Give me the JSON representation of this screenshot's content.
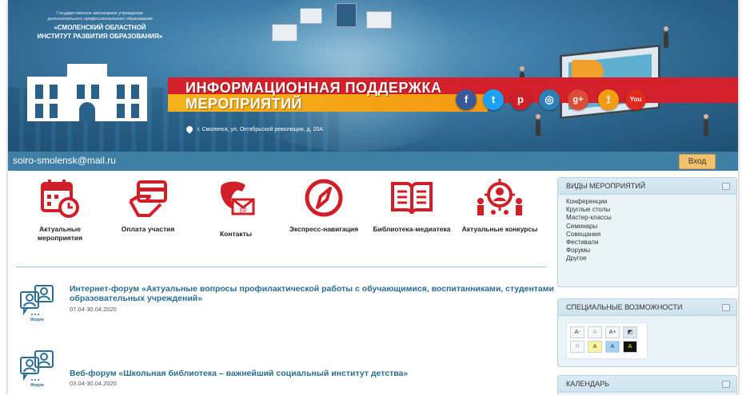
{
  "org": {
    "line1": "Государственное автономное учреждение",
    "line2": "дополнительного профессионального образования",
    "line3": "«СМОЛЕНСКИЙ ОБЛАСТНОЙ",
    "line4": "ИНСТИТУТ РАЗВИТИЯ ОБРАЗОВАНИЯ»"
  },
  "banner": {
    "title_line1": "ИНФОРМАЦИОННАЯ ПОДДЕРЖКА",
    "title_line2": "МЕРОПРИЯТИЙ",
    "address": "г. Смоленск, ул. Октябрьской революции, д. 20А",
    "social": [
      {
        "name": "facebook",
        "glyph": "f",
        "color": "#3b5998"
      },
      {
        "name": "twitter",
        "glyph": "t",
        "color": "#1da1f2"
      },
      {
        "name": "pinterest",
        "glyph": "p",
        "color": "#cb2027"
      },
      {
        "name": "instagram",
        "glyph": "◎",
        "color": "#2d7fb5"
      },
      {
        "name": "google-plus",
        "glyph": "g+",
        "color": "#dd4b39"
      },
      {
        "name": "rss",
        "glyph": "⟟",
        "color": "#f39c12"
      },
      {
        "name": "youtube",
        "glyph": "You",
        "color": "#e02a20"
      }
    ]
  },
  "topbar": {
    "email": "soiro-smolensk@mail.ru",
    "login_label": "Вход"
  },
  "tiles": [
    {
      "icon": "calendar-clock-icon",
      "label": "Актуальные мероприятия"
    },
    {
      "icon": "payment-card-icon",
      "label": "Оплата участия"
    },
    {
      "icon": "phone-mail-icon",
      "label": "Контакты"
    },
    {
      "icon": "compass-icon",
      "label": "Экспресс-навигация"
    },
    {
      "icon": "open-book-icon",
      "label": "Библиотека-медиатека"
    },
    {
      "icon": "people-target-icon",
      "label": "Актуальные конкурсы"
    }
  ],
  "news": [
    {
      "title": "Интернет-форум «Актуальные вопросы профилактической работы с обучающимися, воспитанниками, студентами образовательных учреждений»",
      "date": "07.04-30.04.2020",
      "icon_caption": "Форум"
    },
    {
      "title": "Веб-форум «Школьная библиотека – важнейший социальный институт детства»",
      "date": "03.04-30.04.2020",
      "icon_caption": "Форум"
    }
  ],
  "sidebar": {
    "event_types": {
      "title": "ВИДЫ МЕРОПРИЯТИЙ",
      "items": [
        "Конференции",
        "Круглые столы",
        "Мастер-классы",
        "Семинары",
        "Совещания",
        "Фестивали",
        "Форумы",
        "Другое"
      ]
    },
    "special": {
      "title": "СПЕЦИАЛЬНЫЕ ВОЗМОЖНОСТИ",
      "font_buttons": [
        "A-",
        "A",
        "A+"
      ],
      "color_buttons": [
        "R",
        "A",
        "A",
        "A"
      ]
    },
    "calendar": {
      "title": "КАЛЕНДАРЬ"
    }
  }
}
